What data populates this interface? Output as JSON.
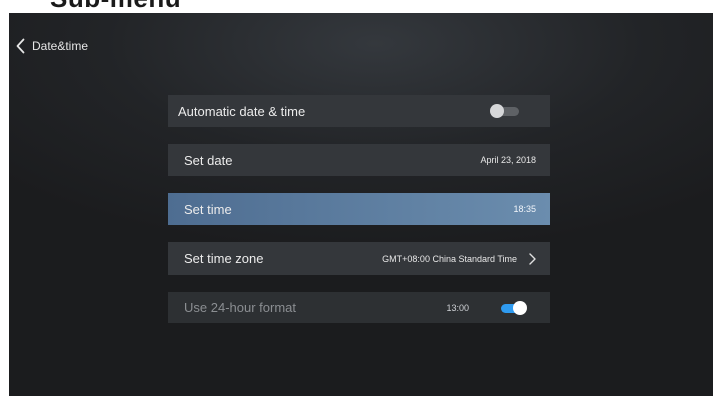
{
  "header": {
    "partial_title": "Sub-menu"
  },
  "nav": {
    "back_label": "Date&time"
  },
  "settings": {
    "automatic": {
      "label": "Automatic date & time",
      "enabled": false
    },
    "date": {
      "label": "Set date",
      "value": "April 23, 2018"
    },
    "time": {
      "label": "Set time",
      "value": "18:35",
      "selected": true
    },
    "zone": {
      "label": "Set time zone",
      "value": "GMT+08:00 China Standard Time"
    },
    "format": {
      "label": "Use 24-hour format",
      "value": "13:00",
      "enabled": true
    }
  },
  "colors": {
    "background": "#1f2123",
    "row": "#34373b",
    "selected_row": "#5d7fa3",
    "toggle_on": "#2f9bf0",
    "toggle_off": "#5e6165"
  },
  "icons": [
    "chevron-left-icon",
    "chevron-right-icon"
  ]
}
